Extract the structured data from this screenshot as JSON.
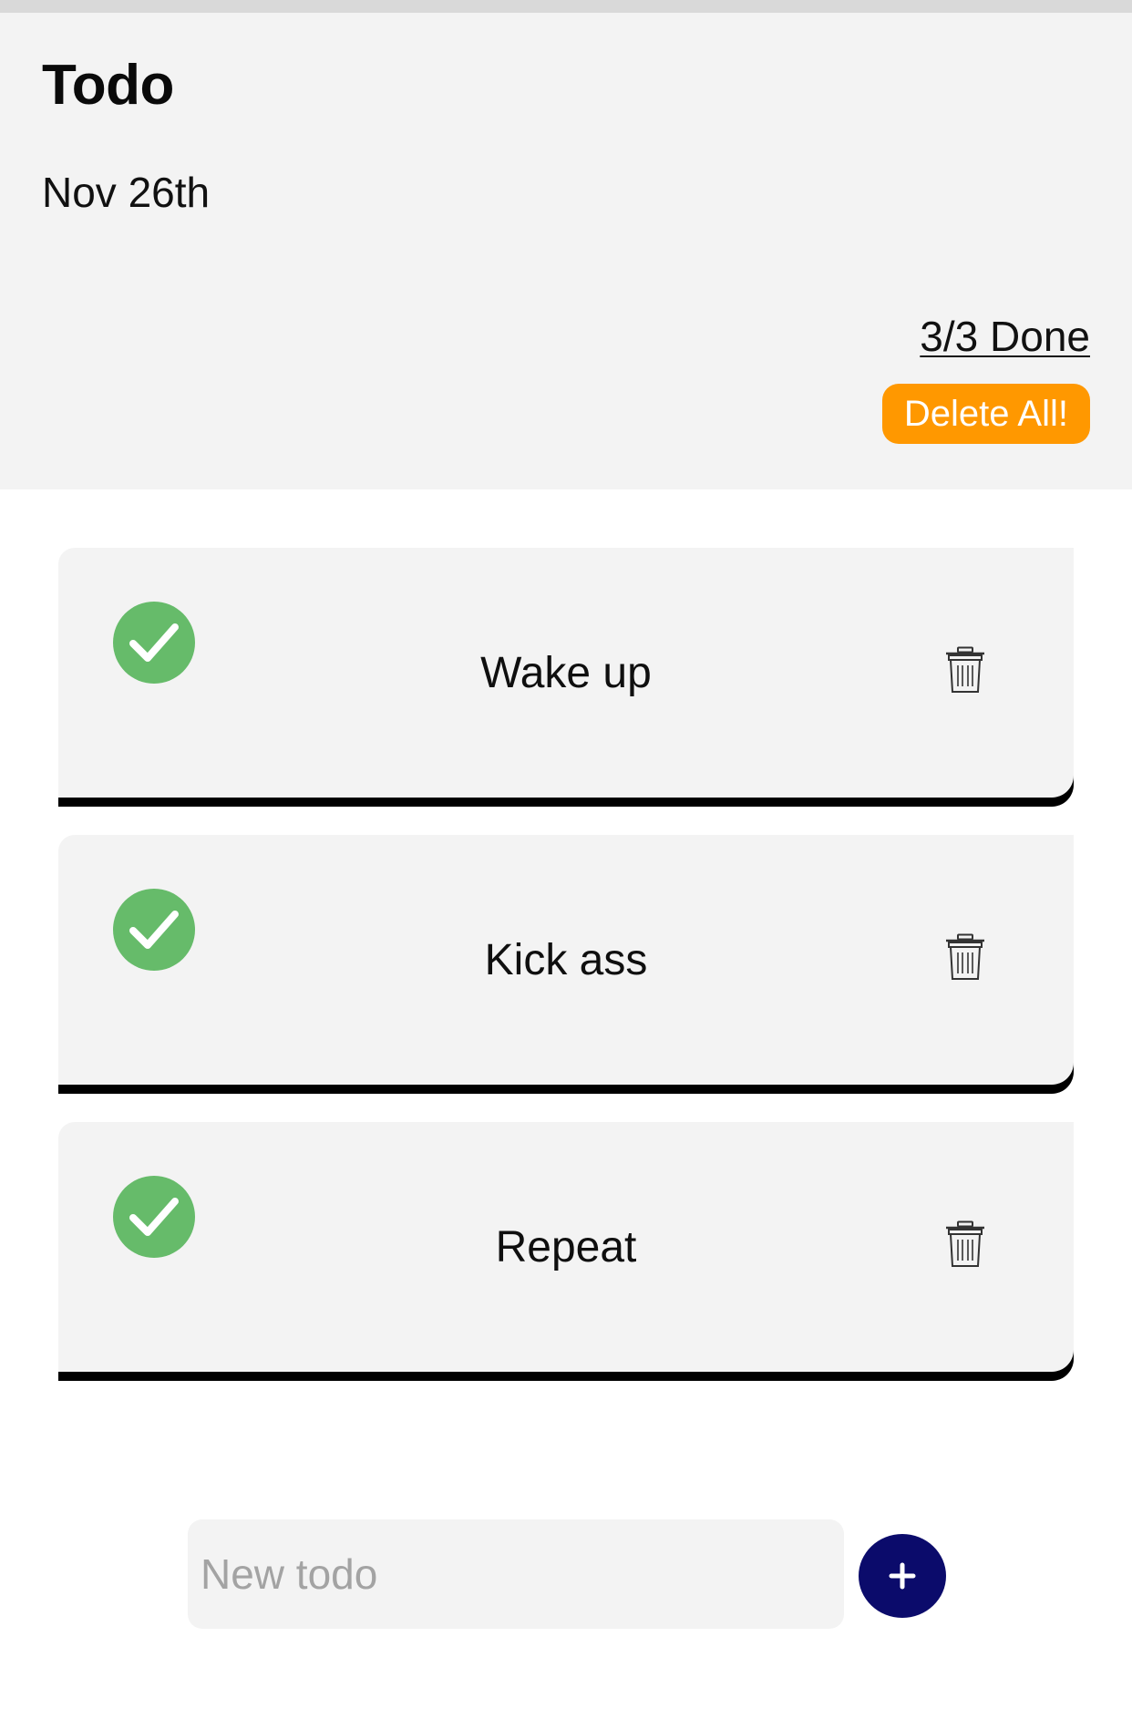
{
  "header": {
    "title": "Todo",
    "date": "Nov 26th",
    "done_count": "3/3 Done",
    "delete_all_label": "Delete All!"
  },
  "todos": [
    {
      "text": "Wake up",
      "done": true,
      "check_icon": "check-circle-icon",
      "delete_icon": "trash-icon"
    },
    {
      "text": "Kick ass",
      "done": true,
      "check_icon": "check-circle-icon",
      "delete_icon": "trash-icon"
    },
    {
      "text": "Repeat",
      "done": true,
      "check_icon": "check-circle-icon",
      "delete_icon": "trash-icon"
    }
  ],
  "new_todo": {
    "placeholder": "New todo",
    "value": "",
    "add_icon": "plus-icon"
  },
  "colors": {
    "header_bg": "#f3f3f3",
    "card_bg": "#f3f3f3",
    "accent_orange": "#ff9800",
    "check_green": "#66bb6a",
    "add_navy": "#0b0b6b"
  }
}
